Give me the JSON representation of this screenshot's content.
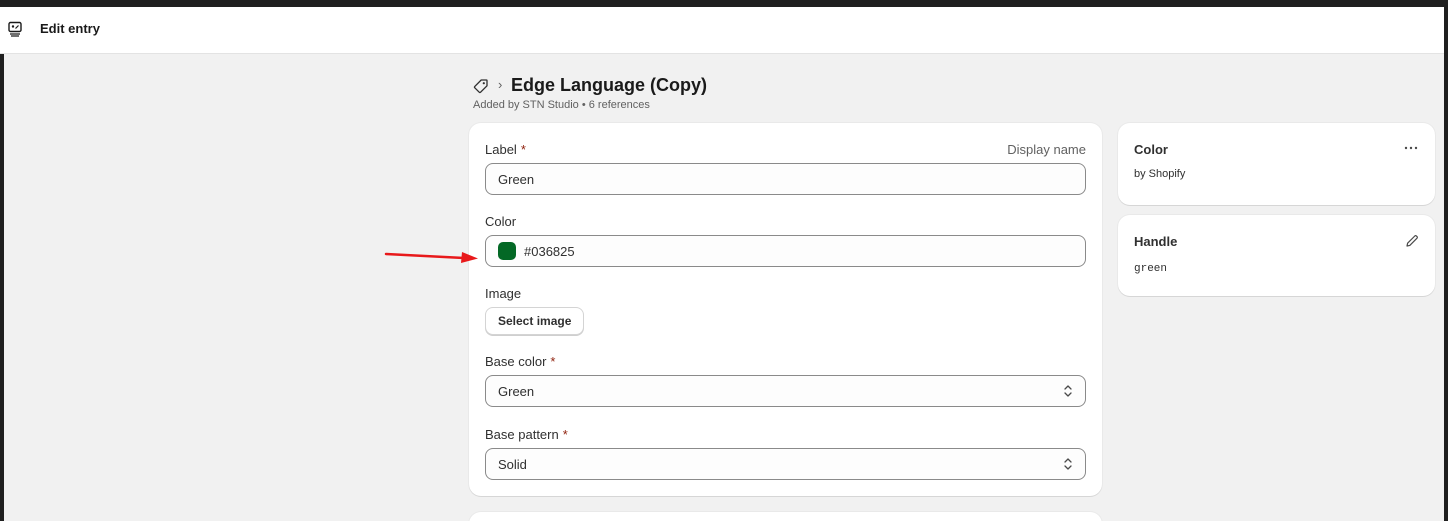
{
  "window": {
    "title": "Edit entry",
    "app_icon": "app-window-icon"
  },
  "header": {
    "breadcrumb_icon": "tag-icon",
    "separator": "›",
    "title": "Edge Language (Copy)",
    "subtitle": "Added by STN Studio • 6 references"
  },
  "form": {
    "label": {
      "label": "Label",
      "required": "*",
      "hint": "Display name",
      "value": "Green"
    },
    "color": {
      "label": "Color",
      "value": "#036825",
      "swatch": "#036825"
    },
    "image": {
      "label": "Image",
      "button": "Select image"
    },
    "base_color": {
      "label": "Base color",
      "required": "*",
      "value": "Green"
    },
    "base_pattern": {
      "label": "Base pattern",
      "required": "*",
      "value": "Solid"
    }
  },
  "sidebar": {
    "color_card": {
      "title": "Color",
      "subtitle": "by Shopify",
      "menu_icon": "more-horizontal-icon"
    },
    "handle_card": {
      "title": "Handle",
      "value": "green",
      "edit_icon": "pencil-icon"
    }
  },
  "annotation": {
    "arrow_color": "#e8191b"
  }
}
